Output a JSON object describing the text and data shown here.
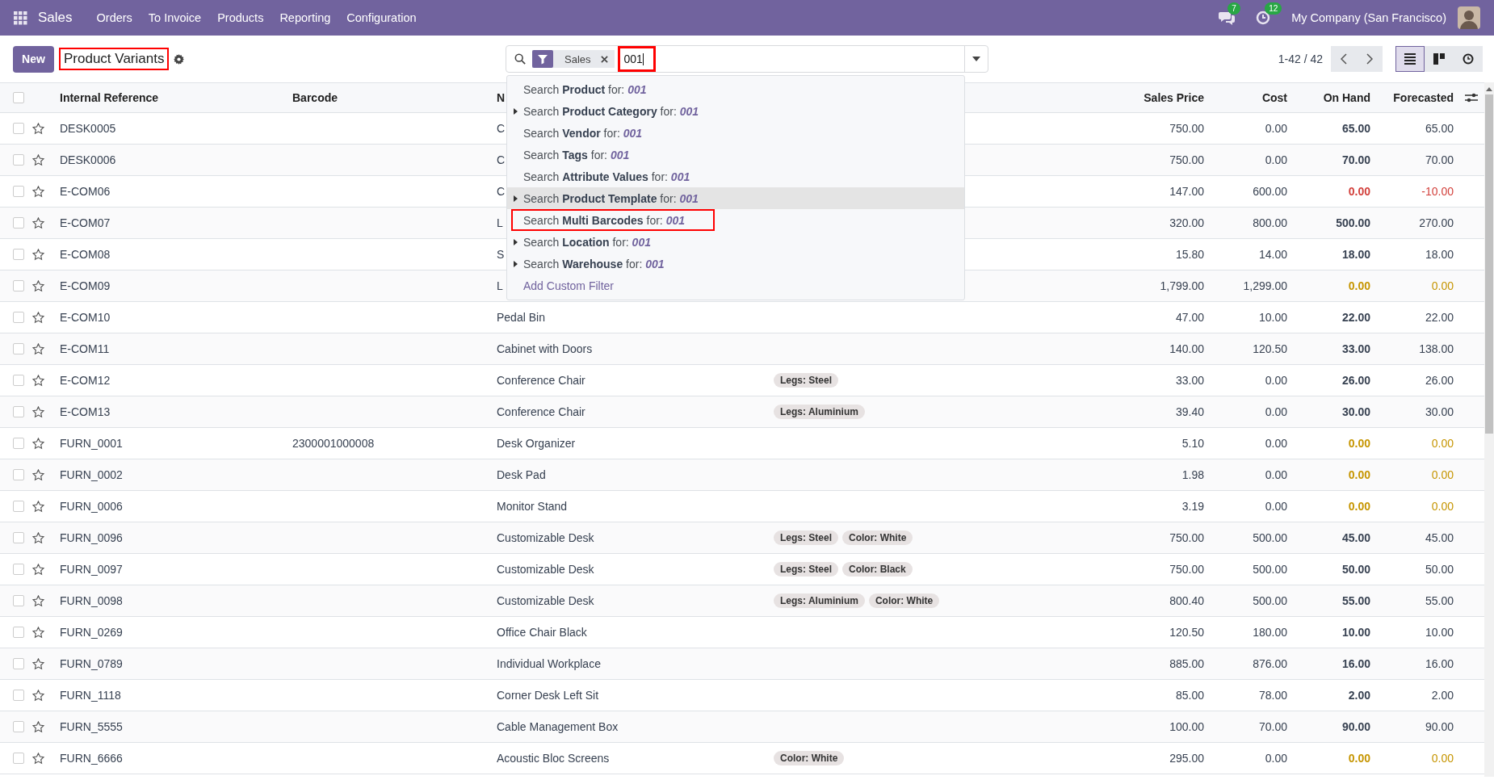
{
  "navbar": {
    "app": "Sales",
    "menu": [
      {
        "label": "Orders"
      },
      {
        "label": "To Invoice"
      },
      {
        "label": "Products"
      },
      {
        "label": "Reporting"
      },
      {
        "label": "Configuration"
      }
    ],
    "messages_count": "7",
    "activities_count": "12",
    "company": "My Company (San Francisco)"
  },
  "control_panel": {
    "new_button": "New",
    "title": "Product Variants",
    "title_highlighted": true,
    "search": {
      "facet": "Sales",
      "value": "001",
      "highlighted": true
    },
    "pager": "1-42 / 42",
    "views": [
      {
        "kind": "list",
        "selected": true
      },
      {
        "kind": "kanban",
        "selected": false
      },
      {
        "kind": "activity",
        "selected": false
      }
    ]
  },
  "search_menu": [
    {
      "text": "Search **Product** for: ",
      "query": "001",
      "expandable": false,
      "focused": false,
      "highlighted": false
    },
    {
      "text": "Search **Product Category** for: ",
      "query": "001",
      "expandable": true,
      "focused": false,
      "highlighted": false
    },
    {
      "text": "Search **Vendor** for: ",
      "query": "001",
      "expandable": false,
      "focused": false,
      "highlighted": false
    },
    {
      "text": "Search **Tags** for: ",
      "query": "001",
      "expandable": false,
      "focused": false,
      "highlighted": false
    },
    {
      "text": "Search **Attribute Values** for: ",
      "query": "001",
      "expandable": false,
      "focused": false,
      "highlighted": false
    },
    {
      "text": "Search **Product Template** for: ",
      "query": "001",
      "expandable": true,
      "focused": true,
      "highlighted": false
    },
    {
      "text": "Search **Multi Barcodes** for: ",
      "query": "001",
      "expandable": false,
      "focused": false,
      "highlighted": true
    },
    {
      "text": "Search **Location** for: ",
      "query": "001",
      "expandable": true,
      "focused": false,
      "highlighted": false
    },
    {
      "text": "Search **Warehouse** for: ",
      "query": "001",
      "expandable": true,
      "focused": false,
      "highlighted": false
    }
  ],
  "search_menu_link": "Add Custom Filter",
  "table": {
    "select_all_checked": false,
    "columns": [
      {
        "label": "Internal Reference"
      },
      {
        "label": "Barcode"
      },
      {
        "label": "N"
      },
      {},
      {
        "label": "Sales Price"
      },
      {
        "label": "Cost"
      },
      {
        "label": "On Hand"
      },
      {
        "label": "Forecasted"
      }
    ],
    "rows": [
      {
        "checked": false,
        "starred": false,
        "ref": "DESK0005",
        "barcode": "",
        "name": "C",
        "tags": [],
        "price": "750.00",
        "cost": "0.00",
        "on_hand": "65.00",
        "forecasted": "65.00",
        "negative": false,
        "out_of_stock": false
      },
      {
        "checked": false,
        "starred": false,
        "ref": "DESK0006",
        "barcode": "",
        "name": "C",
        "tags": [],
        "price": "750.00",
        "cost": "0.00",
        "on_hand": "70.00",
        "forecasted": "70.00",
        "negative": false,
        "out_of_stock": false
      },
      {
        "checked": false,
        "starred": false,
        "ref": "E-COM06",
        "barcode": "",
        "name": "C",
        "tags": [],
        "price": "147.00",
        "cost": "600.00",
        "on_hand": "0.00",
        "forecasted": "-10.00",
        "negative": true,
        "out_of_stock": false
      },
      {
        "checked": false,
        "starred": false,
        "ref": "E-COM07",
        "barcode": "",
        "name": "L",
        "tags": [],
        "price": "320.00",
        "cost": "800.00",
        "on_hand": "500.00",
        "forecasted": "270.00",
        "negative": false,
        "out_of_stock": false
      },
      {
        "checked": false,
        "starred": false,
        "ref": "E-COM08",
        "barcode": "",
        "name": "S",
        "tags": [],
        "price": "15.80",
        "cost": "14.00",
        "on_hand": "18.00",
        "forecasted": "18.00",
        "negative": false,
        "out_of_stock": false
      },
      {
        "checked": false,
        "starred": false,
        "ref": "E-COM09",
        "barcode": "",
        "name": "L",
        "tags": [],
        "price": "1,799.00",
        "cost": "1,299.00",
        "on_hand": "0.00",
        "forecasted": "0.00",
        "negative": false,
        "out_of_stock": true
      },
      {
        "checked": false,
        "starred": false,
        "ref": "E-COM10",
        "barcode": "",
        "name": "Pedal Bin",
        "tags": [],
        "price": "47.00",
        "cost": "10.00",
        "on_hand": "22.00",
        "forecasted": "22.00",
        "negative": false,
        "out_of_stock": false
      },
      {
        "checked": false,
        "starred": false,
        "ref": "E-COM11",
        "barcode": "",
        "name": "Cabinet with Doors",
        "tags": [],
        "price": "140.00",
        "cost": "120.50",
        "on_hand": "33.00",
        "forecasted": "138.00",
        "negative": false,
        "out_of_stock": false
      },
      {
        "checked": false,
        "starred": false,
        "ref": "E-COM12",
        "barcode": "",
        "name": "Conference Chair",
        "tags": [
          "Legs: Steel"
        ],
        "price": "33.00",
        "cost": "0.00",
        "on_hand": "26.00",
        "forecasted": "26.00",
        "negative": false,
        "out_of_stock": false
      },
      {
        "checked": false,
        "starred": false,
        "ref": "E-COM13",
        "barcode": "",
        "name": "Conference Chair",
        "tags": [
          "Legs: Aluminium"
        ],
        "price": "39.40",
        "cost": "0.00",
        "on_hand": "30.00",
        "forecasted": "30.00",
        "negative": false,
        "out_of_stock": false
      },
      {
        "checked": false,
        "starred": false,
        "ref": "FURN_0001",
        "barcode": "2300001000008",
        "name": "Desk Organizer",
        "tags": [],
        "price": "5.10",
        "cost": "0.00",
        "on_hand": "0.00",
        "forecasted": "0.00",
        "negative": false,
        "out_of_stock": true
      },
      {
        "checked": false,
        "starred": false,
        "ref": "FURN_0002",
        "barcode": "",
        "name": "Desk Pad",
        "tags": [],
        "price": "1.98",
        "cost": "0.00",
        "on_hand": "0.00",
        "forecasted": "0.00",
        "negative": false,
        "out_of_stock": true
      },
      {
        "checked": false,
        "starred": false,
        "ref": "FURN_0006",
        "barcode": "",
        "name": "Monitor Stand",
        "tags": [],
        "price": "3.19",
        "cost": "0.00",
        "on_hand": "0.00",
        "forecasted": "0.00",
        "negative": false,
        "out_of_stock": true
      },
      {
        "checked": false,
        "starred": false,
        "ref": "FURN_0096",
        "barcode": "",
        "name": "Customizable Desk",
        "tags": [
          "Legs: Steel",
          "Color: White"
        ],
        "price": "750.00",
        "cost": "500.00",
        "on_hand": "45.00",
        "forecasted": "45.00",
        "negative": false,
        "out_of_stock": false
      },
      {
        "checked": false,
        "starred": false,
        "ref": "FURN_0097",
        "barcode": "",
        "name": "Customizable Desk",
        "tags": [
          "Legs: Steel",
          "Color: Black"
        ],
        "price": "750.00",
        "cost": "500.00",
        "on_hand": "50.00",
        "forecasted": "50.00",
        "negative": false,
        "out_of_stock": false
      },
      {
        "checked": false,
        "starred": false,
        "ref": "FURN_0098",
        "barcode": "",
        "name": "Customizable Desk",
        "tags": [
          "Legs: Aluminium",
          "Color: White"
        ],
        "price": "800.40",
        "cost": "500.00",
        "on_hand": "55.00",
        "forecasted": "55.00",
        "negative": false,
        "out_of_stock": false
      },
      {
        "checked": false,
        "starred": false,
        "ref": "FURN_0269",
        "barcode": "",
        "name": "Office Chair Black",
        "tags": [],
        "price": "120.50",
        "cost": "180.00",
        "on_hand": "10.00",
        "forecasted": "10.00",
        "negative": false,
        "out_of_stock": false
      },
      {
        "checked": false,
        "starred": false,
        "ref": "FURN_0789",
        "barcode": "",
        "name": "Individual Workplace",
        "tags": [],
        "price": "885.00",
        "cost": "876.00",
        "on_hand": "16.00",
        "forecasted": "16.00",
        "negative": false,
        "out_of_stock": false
      },
      {
        "checked": false,
        "starred": false,
        "ref": "FURN_1118",
        "barcode": "",
        "name": "Corner Desk Left Sit",
        "tags": [],
        "price": "85.00",
        "cost": "78.00",
        "on_hand": "2.00",
        "forecasted": "2.00",
        "negative": false,
        "out_of_stock": false
      },
      {
        "checked": false,
        "starred": false,
        "ref": "FURN_5555",
        "barcode": "",
        "name": "Cable Management Box",
        "tags": [],
        "price": "100.00",
        "cost": "70.00",
        "on_hand": "90.00",
        "forecasted": "90.00",
        "negative": false,
        "out_of_stock": false
      },
      {
        "checked": false,
        "starred": false,
        "ref": "FURN_6666",
        "barcode": "",
        "name": "Acoustic Bloc Screens",
        "tags": [
          "Color: White"
        ],
        "price": "295.00",
        "cost": "0.00",
        "on_hand": "0.00",
        "forecasted": "0.00",
        "negative": false,
        "out_of_stock": true
      }
    ]
  }
}
